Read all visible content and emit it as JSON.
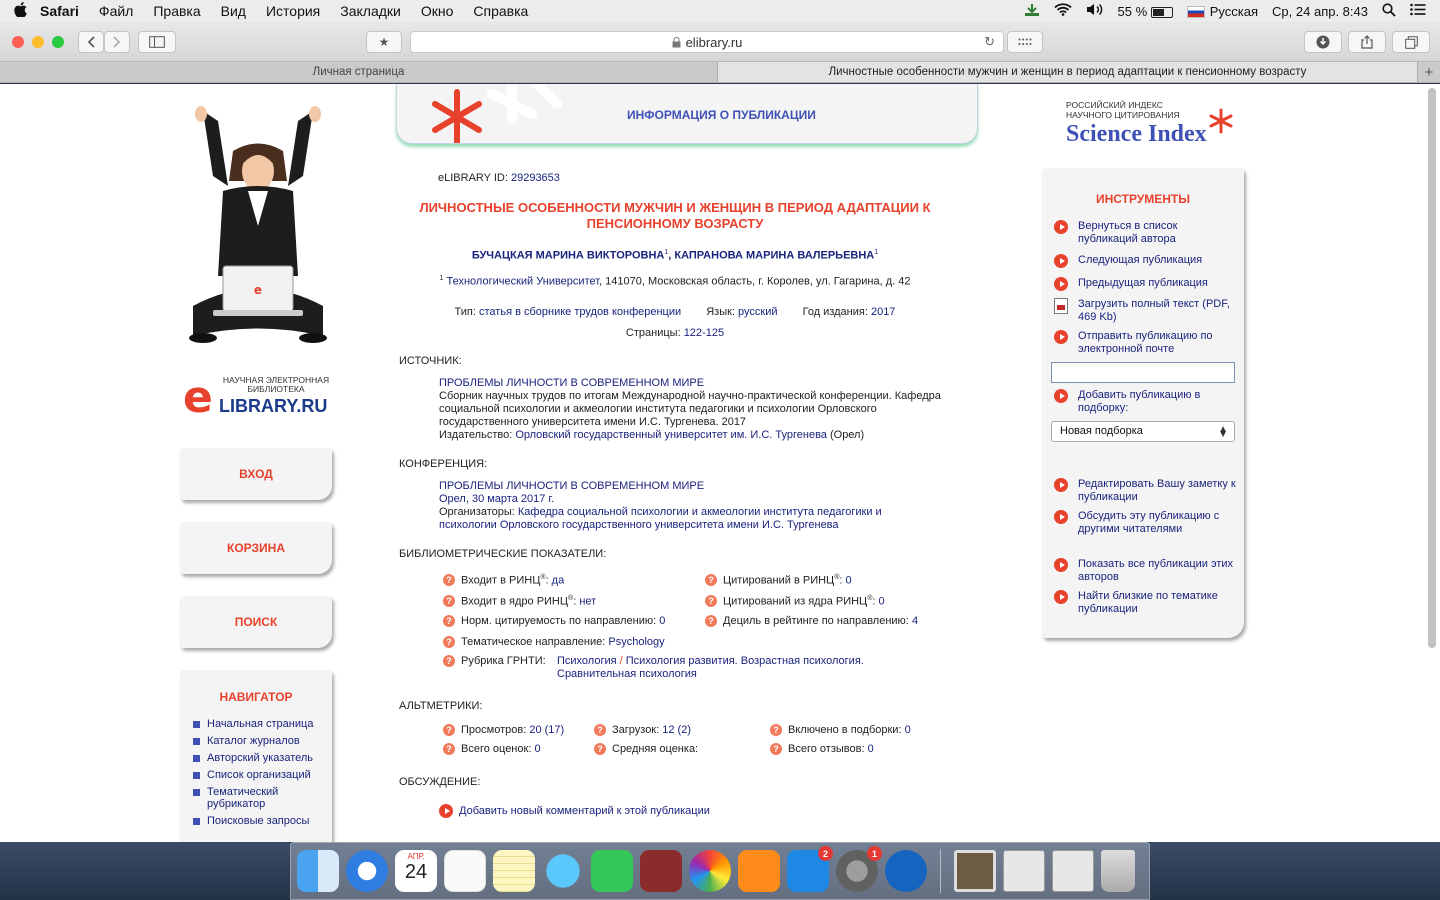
{
  "menubar": {
    "app": "Safari",
    "items": [
      "Файл",
      "Правка",
      "Вид",
      "История",
      "Закладки",
      "Окно",
      "Справка"
    ],
    "battery": "55 %",
    "input_lang": "Русская",
    "datetime": "Ср, 24 апр.  8:43"
  },
  "toolbar": {
    "url": "elibrary.ru"
  },
  "tabs": [
    {
      "label": "Личная страница"
    },
    {
      "label": "Личностные особенности мужчин и женщин в период адаптации к пенсионному возрасту"
    }
  ],
  "left": {
    "logo_top": "НАУЧНАЯ ЭЛЕКТРОННАЯ БИБЛИОТЕКА",
    "logo_text": "LIBRARY.RU",
    "logo_letter": "e",
    "buttons": {
      "login": "ВХОД",
      "cart": "КОРЗИНА",
      "search": "ПОИСК"
    },
    "navigator": {
      "title": "НАВИГАТОР",
      "items": [
        "Начальная страница",
        "Каталог журналов",
        "Авторский указатель",
        "Список организаций",
        "Тематический рубрикатор",
        "Поисковые запросы"
      ]
    }
  },
  "header": {
    "title": "ИНФОРМАЦИЯ О ПУБЛИКАЦИИ"
  },
  "publication": {
    "id_label": "eLIBRARY ID:",
    "id": "29293653",
    "title": "ЛИЧНОСТНЫЕ ОСОБЕННОСТИ МУЖЧИН И ЖЕНЩИН В ПЕРИОД АДАПТАЦИИ К ПЕНСИОННОМУ ВОЗРАСТУ",
    "author1": "БУЧАЦКАЯ МАРИНА ВИКТОРОВНА",
    "author2": "КАПРАНОВА МАРИНА ВАЛЕРЬЕВНА",
    "sup": "1",
    "affil_org": "Технологический Университет",
    "affil_addr": ", 141070, Московская область, г. Королев, ул. Гагарина, д. 42",
    "type_label": "Тип:",
    "type": "статья в сборнике трудов конференции",
    "lang_label": "Язык:",
    "lang": "русский",
    "year_label": "Год издания:",
    "year": "2017",
    "pages_label": "Страницы:",
    "pages": "122-125"
  },
  "source": {
    "heading": "ИСТОЧНИК:",
    "title": "ПРОБЛЕМЫ ЛИЧНОСТИ В СОВРЕМЕННОМ МИРЕ",
    "desc": "Сборник научных трудов по итогам Международной научно-практической конференции. Кафедра социальной психологии и акмеологии института педагогики и психологии Орловского государственного университета имени И.С. Тургенева. 2017",
    "publisher_label": "Издательство:",
    "publisher": "Орловский государственный университет им. И.С. Тургенева",
    "publisher_city": "(Орел)"
  },
  "conference": {
    "heading": "КОНФЕРЕНЦИЯ:",
    "title": "ПРОБЛЕМЫ ЛИЧНОСТИ В СОВРЕМЕННОМ МИРЕ",
    "place": "Орел, 30 марта 2017 г.",
    "org_label": "Организаторы:",
    "org": "Кафедра социальной психологии и акмеологии института педагогики и психологии Орловского государственного университета имени И.С. Тургенева"
  },
  "biblio": {
    "heading": "БИБЛИОМЕТРИЧЕСКИЕ ПОКАЗАТЕЛИ:",
    "rinc_label": "Входит в РИНЦ",
    "rinc": "да",
    "core_label": "Входит в ядро РИНЦ",
    "core": "нет",
    "norm_label": "Норм. цитируемость по направлению:",
    "norm": "0",
    "cit_label": "Цитирований в РИНЦ",
    "cit": "0",
    "cit_core_label": "Цитирований из ядра РИНЦ",
    "cit_core": "0",
    "decile_label": "Дециль в рейтинге по направлению:",
    "decile": "4",
    "topic_label": "Тематическое направление:",
    "topic": "Psychology",
    "grnti_label": "Рубрика ГРНТИ:",
    "grnti1": "Психология",
    "grnti_sep": "/",
    "grnti2": "Психология развития. Возрастная психология. Сравнительная психология",
    "reg": "®",
    "colon": ":"
  },
  "alt": {
    "heading": "АЛЬТМЕТРИКИ:",
    "views_label": "Просмотров:",
    "views": "20 (17)",
    "downloads_label": "Загрузок:",
    "downloads": "12 (2)",
    "in_sets_label": "Включено в подборки:",
    "in_sets": "0",
    "ratings_label": "Всего оценок:",
    "ratings": "0",
    "avg_label": "Средняя оценка:",
    "reviews_label": "Всего отзывов:",
    "reviews": "0"
  },
  "discussion": {
    "heading": "ОБСУЖДЕНИЕ:",
    "add": "Добавить новый комментарий к этой публикации"
  },
  "science_index": {
    "small": "РОССИЙСКИЙ ИНДЕКС НАУЧНОГО ЦИТИРОВАНИЯ",
    "big": "Science Index"
  },
  "tools": {
    "title": "ИНСТРУМЕНТЫ",
    "back": "Вернуться в список публикаций автора",
    "next": "Следующая публикация",
    "prev": "Предыдущая публикация",
    "download": "Загрузить полный текст (PDF, 469 Kb)",
    "email": "Отправить публикацию по электронной почте",
    "add_set": "Добавить публикацию в подборку:",
    "select": "Новая подборка",
    "edit_note": "Редактировать Вашу заметку к публикации",
    "discuss": "Обсудить эту публикацию с другими читателями",
    "show_all": "Показать все публикации этих авторов",
    "similar": "Найти близкие по тематике публикации"
  },
  "dock": {
    "calendar_month": "АПР.",
    "calendar_day": "24",
    "appstore_badge": "2",
    "prefs_badge": "1"
  },
  "colors": {
    "accent": "#e8412c",
    "link": "#1a237e",
    "nav_square": "#3f51b5"
  }
}
